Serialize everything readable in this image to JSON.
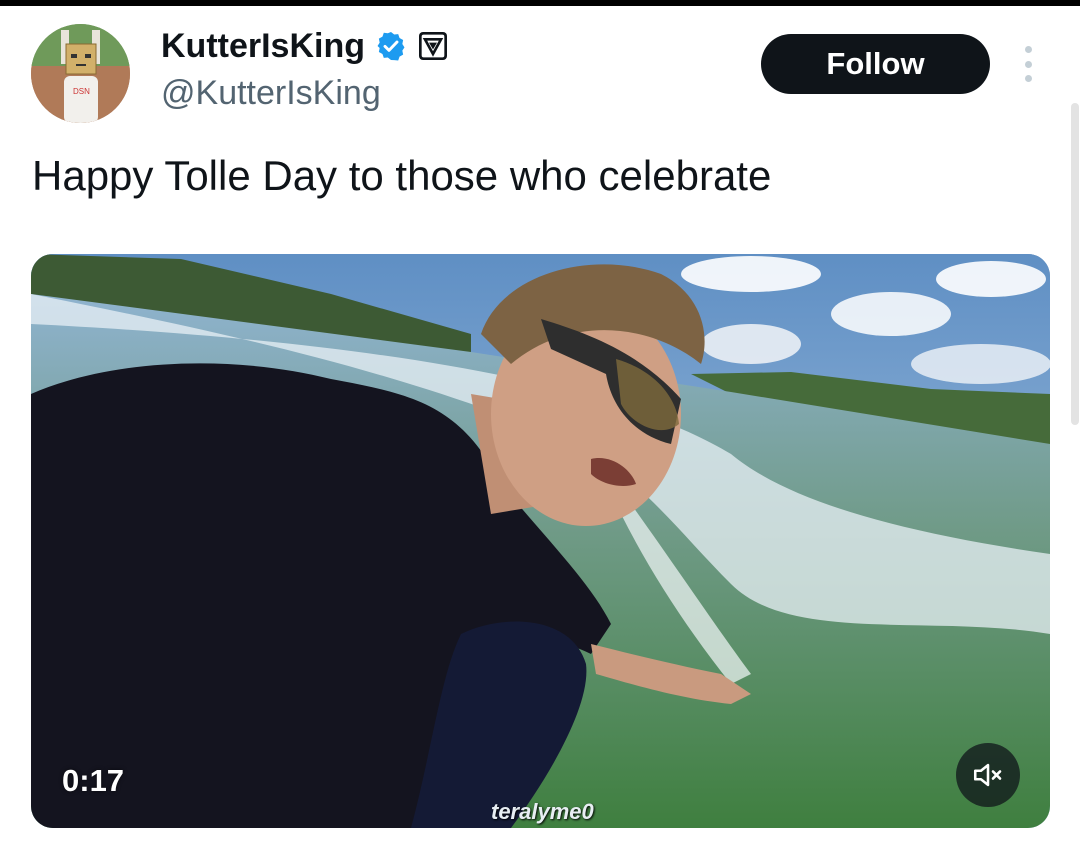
{
  "tweet": {
    "author": {
      "display_name": "KutterIsKing",
      "handle": "@KutterIsKing",
      "verified": true,
      "verified_color": "#1d9bf0"
    },
    "follow_label": "Follow",
    "text": "Happy Tolle Day to those who celebrate",
    "media": {
      "type": "video",
      "duration": "0:17",
      "watermark": "teralyme0",
      "muted": true
    }
  },
  "icons": {
    "verified": "verified-badge-icon",
    "affiliate": "affiliate-badge-icon",
    "more": "more-options-icon",
    "mute": "muted-speaker-icon"
  },
  "colors": {
    "text_primary": "#0f1419",
    "text_secondary": "#536471",
    "button_bg": "#0f1419",
    "button_text": "#ffffff"
  }
}
